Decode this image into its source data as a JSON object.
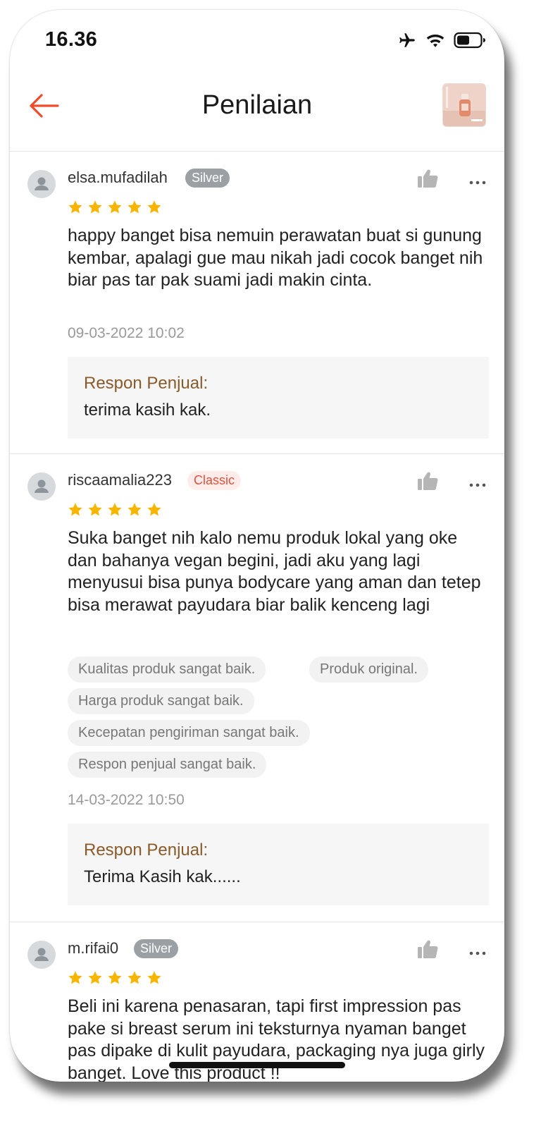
{
  "status_bar": {
    "time": "16.36",
    "icons": [
      "airplane-icon",
      "wifi-icon",
      "battery-icon"
    ]
  },
  "header": {
    "back_icon": "back-arrow-icon",
    "title": "Penilaian",
    "thumbnail": "product-thumbnail"
  },
  "colors": {
    "accent": "#ee4d2d",
    "star": "#f7b500",
    "reply_label": "#8a5a2a",
    "silver_badge": "#9aa0a4",
    "classic_badge_text": "#e2503c"
  },
  "reviews": [
    {
      "username": "elsa.mufadilah",
      "badge": "Silver",
      "rating": 5,
      "text": "happy banget bisa nemuin perawatan buat si gunung kembar, apalagi gue mau nikah jadi cocok banget nih biar pas tar pak suami jadi makin cinta.",
      "date": "09-03-2022 10:02",
      "seller_reply_label": "Respon Penjual:",
      "seller_reply": "terima kasih kak."
    },
    {
      "username": "riscaamalia223",
      "badge": "Classic",
      "rating": 5,
      "text": "Suka banget nih kalo nemu produk lokal yang oke dan bahanya vegan begini, jadi aku yang lagi menyusui bisa punya bodycare yang aman dan tetep bisa merawat payudara biar balik kenceng lagi",
      "tags": [
        "Kualitas produk sangat baik.",
        "Produk original.",
        "Harga produk sangat baik.",
        "Kecepatan pengiriman sangat baik.",
        "Respon penjual sangat baik."
      ],
      "date": "14-03-2022 10:50",
      "seller_reply_label": "Respon Penjual:",
      "seller_reply": "Terima Kasih kak......"
    },
    {
      "username": "m.rifai0",
      "badge": "Silver",
      "rating": 5,
      "text": "Beli ini karena penasaran, tapi first impression pas pake si breast serum ini teksturnya nyaman banget pas dipake di kulit payudara, packaging nya juga girly banget. Love this product !!"
    }
  ]
}
